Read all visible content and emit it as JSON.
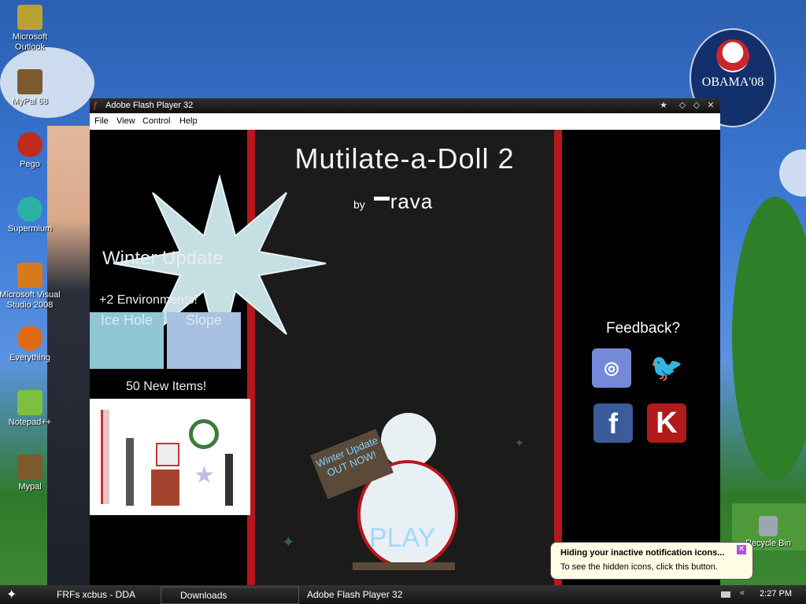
{
  "desktop": {
    "icons": [
      {
        "label": "Microsoft Outlook",
        "icon": "outlook-icon",
        "color": "#b9a234"
      },
      {
        "label": "MyPal 68",
        "icon": "mypal-icon",
        "color": "#7c5a2e"
      },
      {
        "label": "Pego",
        "icon": "pego-icon",
        "color": "#c02b1f"
      },
      {
        "label": "Supermium",
        "icon": "supermium-icon",
        "color": "#2ab0a7"
      },
      {
        "label": "Microsoft Visual Studio 2008",
        "icon": "visual-studio-icon",
        "color": "#d67b1c"
      },
      {
        "label": "Everything",
        "icon": "everything-icon",
        "color": "#e06a14"
      },
      {
        "label": "Notepad++",
        "icon": "notepad-icon",
        "color": "#7fbf3f"
      },
      {
        "label": "Mypal",
        "icon": "mypal2-icon",
        "color": "#7c5a2e"
      }
    ],
    "recycle_bin": "Recycle Bin",
    "badge_text": "OBAMA'08"
  },
  "window": {
    "title": "Adobe Flash Player 32",
    "menu": [
      "File",
      "View",
      "Control",
      "Help"
    ]
  },
  "game": {
    "title": "Mutilate-a-Doll 2",
    "by": "by",
    "author": "rava",
    "winter_update": "Winter Update",
    "environments": "+2 Environments!",
    "map1": "Ice Hole",
    "map2": "Slope",
    "items_text": "50 New Items!",
    "feedback": "Feedback?",
    "sign": "Winter Update OUT NOW!",
    "play": "PLAY"
  },
  "taskbar": {
    "items": [
      "FRFs xcbus - DDA",
      "Downloads",
      "Adobe Flash Player 32"
    ],
    "time": "2:27 PM"
  },
  "balloon": {
    "title": "Hiding your inactive notification icons...",
    "body": "To see the hidden icons, click this button."
  }
}
